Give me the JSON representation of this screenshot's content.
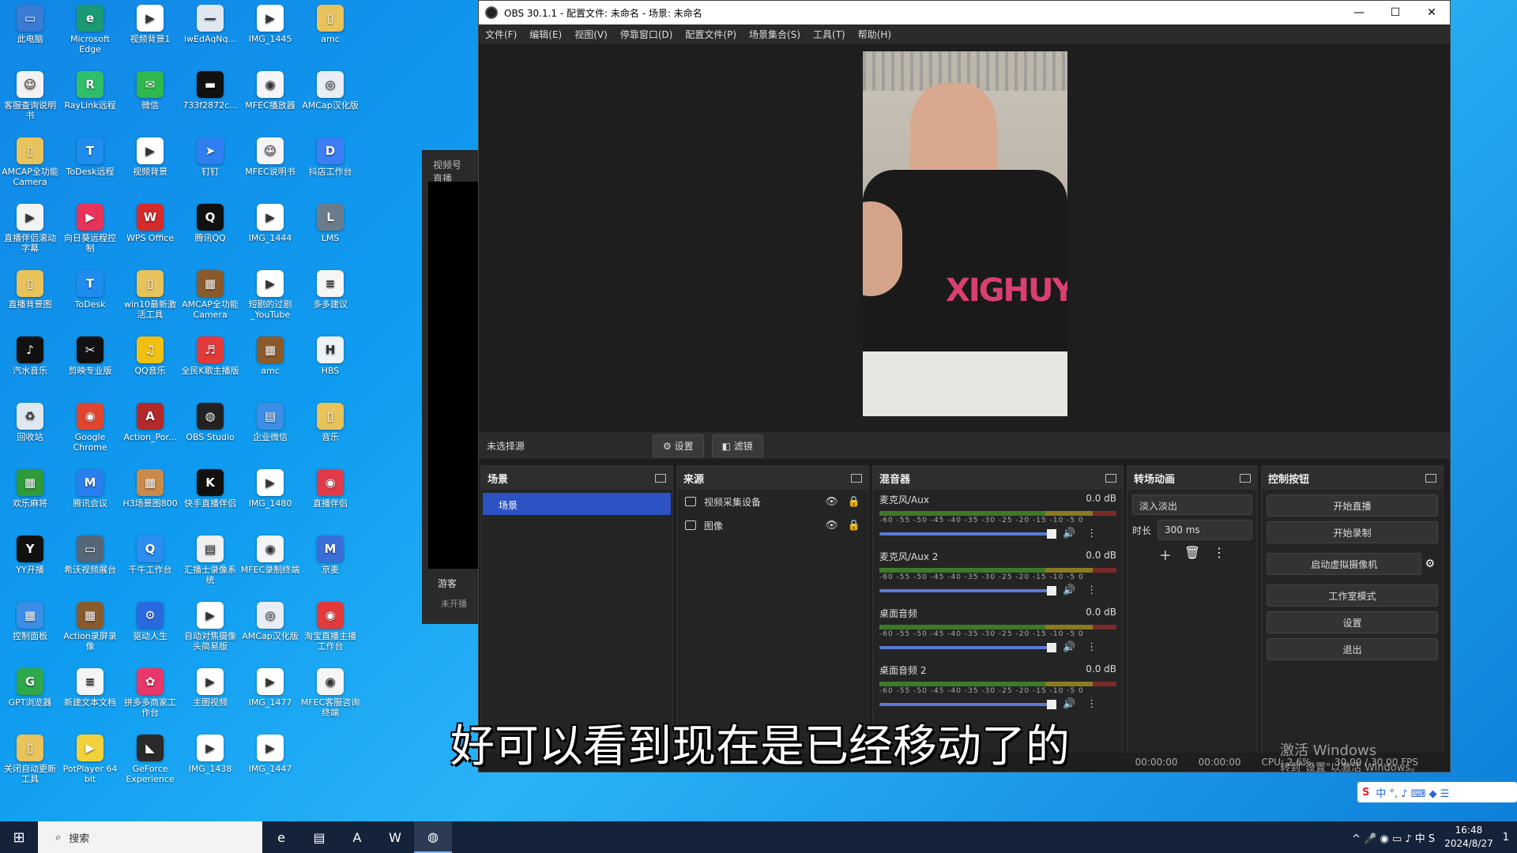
{
  "desktop_icons": [
    {
      "label": "此电脑",
      "color": "#3a7bd5",
      "glyph": "▭",
      "col": 0,
      "row": 0
    },
    {
      "label": "Microsoft Edge",
      "color": "#1a9a74",
      "glyph": "e",
      "col": 1,
      "row": 0
    },
    {
      "label": "视频背景1",
      "color": "#ffffff",
      "glyph": "▶",
      "col": 2,
      "row": 0
    },
    {
      "label": "iwEdAqNq...",
      "color": "#dfe7f0",
      "glyph": "—",
      "col": 3,
      "row": 0
    },
    {
      "label": "IMG_1445",
      "color": "#ffffff",
      "glyph": "▶",
      "col": 4,
      "row": 0
    },
    {
      "label": "amc",
      "color": "#e8c25a",
      "glyph": "▯",
      "col": 5,
      "row": 0
    },
    {
      "label": "客服查询说明书",
      "color": "#f2f2f2",
      "glyph": "☺",
      "col": 0,
      "row": 1
    },
    {
      "label": "RayLink远程",
      "color": "#2fbf6a",
      "glyph": "R",
      "col": 1,
      "row": 1
    },
    {
      "label": "微信",
      "color": "#2fb84c",
      "glyph": "✉",
      "col": 2,
      "row": 1
    },
    {
      "label": "733f2872c...",
      "color": "#111111",
      "glyph": "▬",
      "col": 3,
      "row": 1
    },
    {
      "label": "MFEC播放器",
      "color": "#f5f5f5",
      "glyph": "◉",
      "col": 4,
      "row": 1
    },
    {
      "label": "AMCap汉化版",
      "color": "#e8eef4",
      "glyph": "◎",
      "col": 5,
      "row": 1
    },
    {
      "label": "AMCAP全功能Camera",
      "color": "#e8c25a",
      "glyph": "▯",
      "col": 0,
      "row": 2
    },
    {
      "label": "ToDesk远程",
      "color": "#1f8cf0",
      "glyph": "T",
      "col": 1,
      "row": 2
    },
    {
      "label": "视频背景",
      "color": "#ffffff",
      "glyph": "▶",
      "col": 2,
      "row": 2
    },
    {
      "label": "钉钉",
      "color": "#2f7ff0",
      "glyph": "➤",
      "col": 3,
      "row": 2
    },
    {
      "label": "MFEC说明书",
      "color": "#f5f5f5",
      "glyph": "☺",
      "col": 4,
      "row": 2
    },
    {
      "label": "抖店工作台",
      "color": "#3c7ef5",
      "glyph": "D",
      "col": 5,
      "row": 2
    },
    {
      "label": "直播伴侣滚动字幕",
      "color": "#f3f3f3",
      "glyph": "▶",
      "col": 0,
      "row": 3
    },
    {
      "label": "向日葵远程控制",
      "color": "#e8335a",
      "glyph": "▶",
      "col": 1,
      "row": 3
    },
    {
      "label": "WPS Office",
      "color": "#d62b2b",
      "glyph": "W",
      "col": 2,
      "row": 3
    },
    {
      "label": "腾讯QQ",
      "color": "#111111",
      "glyph": "Q",
      "col": 3,
      "row": 3
    },
    {
      "label": "IMG_1444",
      "color": "#ffffff",
      "glyph": "▶",
      "col": 4,
      "row": 3
    },
    {
      "label": "LMS",
      "color": "#6b7d8c",
      "glyph": "L",
      "col": 5,
      "row": 3
    },
    {
      "label": "直播背景图",
      "color": "#e8c25a",
      "glyph": "▯",
      "col": 0,
      "row": 4
    },
    {
      "label": "ToDesk",
      "color": "#1f8cf0",
      "glyph": "T",
      "col": 1,
      "row": 4
    },
    {
      "label": "win10最新激活工具",
      "color": "#e8c25a",
      "glyph": "▯",
      "col": 2,
      "row": 4
    },
    {
      "label": "AMCAP全功能Camera",
      "color": "#8a5a2a",
      "glyph": "▦",
      "col": 3,
      "row": 4
    },
    {
      "label": "短剧的过剧_YouTube",
      "color": "#ffffff",
      "glyph": "▶",
      "col": 4,
      "row": 4
    },
    {
      "label": "多多建议",
      "color": "#f5f5f5",
      "glyph": "≡",
      "col": 5,
      "row": 4
    },
    {
      "label": "汽水音乐",
      "color": "#111111",
      "glyph": "♪",
      "col": 0,
      "row": 5
    },
    {
      "label": "剪映专业版",
      "color": "#111111",
      "glyph": "✂",
      "col": 1,
      "row": 5
    },
    {
      "label": "QQ音乐",
      "color": "#f2c012",
      "glyph": "♫",
      "col": 2,
      "row": 5
    },
    {
      "label": "全民K歌主播版",
      "color": "#e23a3a",
      "glyph": "♬",
      "col": 3,
      "row": 5
    },
    {
      "label": "amc",
      "color": "#8a5a2a",
      "glyph": "▦",
      "col": 4,
      "row": 5
    },
    {
      "label": "HBS",
      "color": "#eef3f8",
      "glyph": "H",
      "col": 5,
      "row": 5
    },
    {
      "label": "回收站",
      "color": "#dfe7f0",
      "glyph": "♻",
      "col": 0,
      "row": 6
    },
    {
      "label": "Google Chrome",
      "color": "#e0452f",
      "glyph": "◉",
      "col": 1,
      "row": 6
    },
    {
      "label": "Action_Por...",
      "color": "#b22a2a",
      "glyph": "A",
      "col": 2,
      "row": 6
    },
    {
      "label": "OBS Studio",
      "color": "#222222",
      "glyph": "◍",
      "col": 3,
      "row": 6
    },
    {
      "label": "企业微信",
      "color": "#3c8ee6",
      "glyph": "▤",
      "col": 4,
      "row": 6
    },
    {
      "label": "音乐",
      "color": "#e8c25a",
      "glyph": "▯",
      "col": 5,
      "row": 6
    },
    {
      "label": "欢乐麻将",
      "color": "#2f9a3a",
      "glyph": "▦",
      "col": 0,
      "row": 7
    },
    {
      "label": "腾讯会议",
      "color": "#2a7ff0",
      "glyph": "M",
      "col": 1,
      "row": 7
    },
    {
      "label": "H3场景图800",
      "color": "#c98a4a",
      "glyph": "▦",
      "col": 2,
      "row": 7
    },
    {
      "label": "快手直播伴侣",
      "color": "#111111",
      "glyph": "K",
      "col": 3,
      "row": 7
    },
    {
      "label": "IMG_1480",
      "color": "#ffffff",
      "glyph": "▶",
      "col": 4,
      "row": 7
    },
    {
      "label": "直播伴侣",
      "color": "#e23a4a",
      "glyph": "◉",
      "col": 5,
      "row": 7
    },
    {
      "label": "YY开播",
      "color": "#111111",
      "glyph": "Y",
      "col": 0,
      "row": 8
    },
    {
      "label": "希沃视频展台",
      "color": "#556677",
      "glyph": "▭",
      "col": 1,
      "row": 8
    },
    {
      "label": "千牛工作台",
      "color": "#2a8ff0",
      "glyph": "Q",
      "col": 2,
      "row": 8
    },
    {
      "label": "汇播士录像系统",
      "color": "#f0f0f0",
      "glyph": "▤",
      "col": 3,
      "row": 8
    },
    {
      "label": "MFEC录制终端",
      "color": "#f5f5f5",
      "glyph": "◉",
      "col": 4,
      "row": 8
    },
    {
      "label": "京麦",
      "color": "#3a6ed8",
      "glyph": "M",
      "col": 5,
      "row": 8
    },
    {
      "label": "控制面板",
      "color": "#3a8ee6",
      "glyph": "▦",
      "col": 0,
      "row": 9
    },
    {
      "label": "Action录屏录像",
      "color": "#8a5a2a",
      "glyph": "▦",
      "col": 1,
      "row": 9
    },
    {
      "label": "驱动人生",
      "color": "#2a6ae0",
      "glyph": "⚙",
      "col": 2,
      "row": 9
    },
    {
      "label": "自动对焦摄像头简易版",
      "color": "#ffffff",
      "glyph": "▶",
      "col": 3,
      "row": 9
    },
    {
      "label": "AMCap汉化版",
      "color": "#e8eef4",
      "glyph": "◎",
      "col": 4,
      "row": 9
    },
    {
      "label": "淘宝直播主播工作台",
      "color": "#e23a3a",
      "glyph": "◉",
      "col": 5,
      "row": 9
    },
    {
      "label": "GPT浏览器",
      "color": "#2fa84c",
      "glyph": "G",
      "col": 0,
      "row": 10
    },
    {
      "label": "新建文本文档",
      "color": "#f5f5f5",
      "glyph": "≡",
      "col": 1,
      "row": 10
    },
    {
      "label": "拼多多商家工作台",
      "color": "#e8386a",
      "glyph": "✿",
      "col": 2,
      "row": 10
    },
    {
      "label": "主图视频",
      "color": "#ffffff",
      "glyph": "▶",
      "col": 3,
      "row": 10
    },
    {
      "label": "IMG_1477",
      "color": "#ffffff",
      "glyph": "▶",
      "col": 4,
      "row": 10
    },
    {
      "label": "MFEC客服咨询终端",
      "color": "#f5f5f5",
      "glyph": "◉",
      "col": 5,
      "row": 10
    },
    {
      "label": "关闭自动更新工具",
      "color": "#e8c25a",
      "glyph": "▯",
      "col": 0,
      "row": 11
    },
    {
      "label": "PotPlayer 64 bit",
      "color": "#f2d23a",
      "glyph": "▶",
      "col": 1,
      "row": 11
    },
    {
      "label": "GeForce Experience",
      "color": "#2a2a2a",
      "glyph": "◣",
      "col": 2,
      "row": 11
    },
    {
      "label": "IMG_1438",
      "color": "#ffffff",
      "glyph": "▶",
      "col": 3,
      "row": 11
    },
    {
      "label": "IMG_1447",
      "color": "#ffffff",
      "glyph": "▶",
      "col": 4,
      "row": 11
    }
  ],
  "bg_window": {
    "title": "视频号直播",
    "user": "游客",
    "status": "未开播"
  },
  "obs": {
    "title": "OBS 30.1.1 - 配置文件: 未命名 - 场景: 未命名",
    "window_controls": [
      "—",
      "☐",
      "✕"
    ],
    "menu": [
      "文件(F)",
      "编辑(E)",
      "视图(V)",
      "停靠窗口(D)",
      "配置文件(P)",
      "场景集合(S)",
      "工具(T)",
      "帮助(H)"
    ],
    "preview_text": "XIGHUY",
    "no_source": "未选择源",
    "settings_btn": "⚙ 设置",
    "filters_btn": "◧ 滤镜",
    "docks": {
      "scenes": {
        "title": "场景",
        "items": [
          "场景"
        ]
      },
      "sources": {
        "title": "来源",
        "items": [
          {
            "name": "视频采集设备",
            "icon": "camera-icon"
          },
          {
            "name": "图像",
            "icon": "image-icon"
          }
        ]
      },
      "mixer": {
        "title": "混音器",
        "channels": [
          {
            "name": "麦克风/Aux",
            "db": "0.0 dB"
          },
          {
            "name": "麦克风/Aux 2",
            "db": "0.0 dB"
          },
          {
            "name": "桌面音频",
            "db": "0.0 dB"
          },
          {
            "name": "桌面音频 2",
            "db": "0.0 dB"
          }
        ],
        "scale": "-60 -55 -50 -45 -40 -35 -30 -25 -20 -15 -10 -5 0"
      },
      "transitions": {
        "title": "转场动画",
        "type": "淡入淡出",
        "duration_label": "时长",
        "duration": "300 ms"
      },
      "controls": {
        "title": "控制按钮",
        "buttons": [
          "开始直播",
          "开始录制",
          "启动虚拟摄像机",
          "工作室模式",
          "设置",
          "退出"
        ]
      }
    },
    "status": {
      "rec": "00:00:00",
      "stream": "00:00:00",
      "cpu": "CPU: 2.6%,",
      "fps": "30.00 / 30.00 FPS"
    }
  },
  "subtitle": "好可以看到现在是已经移动了的",
  "activate": {
    "line1": "激活 Windows",
    "line2": "转到\"设置\"以激活 Windows。"
  },
  "ime": {
    "logo": "S",
    "text": "中 °, ♪ ⌨ ◆ ☰"
  },
  "taskbar": {
    "start": "⊞",
    "search_placeholder": "搜索",
    "apps": [
      "e",
      "▤",
      "A",
      "W",
      "◍"
    ],
    "tray": "^ 🎤 ◉ ▭ ♪ 中 S",
    "time": "16:48",
    "date": "2024/8/27",
    "notif": "1"
  },
  "colors": {
    "accent": "#2d52c4",
    "obs_bg": "#1e1e1e"
  }
}
